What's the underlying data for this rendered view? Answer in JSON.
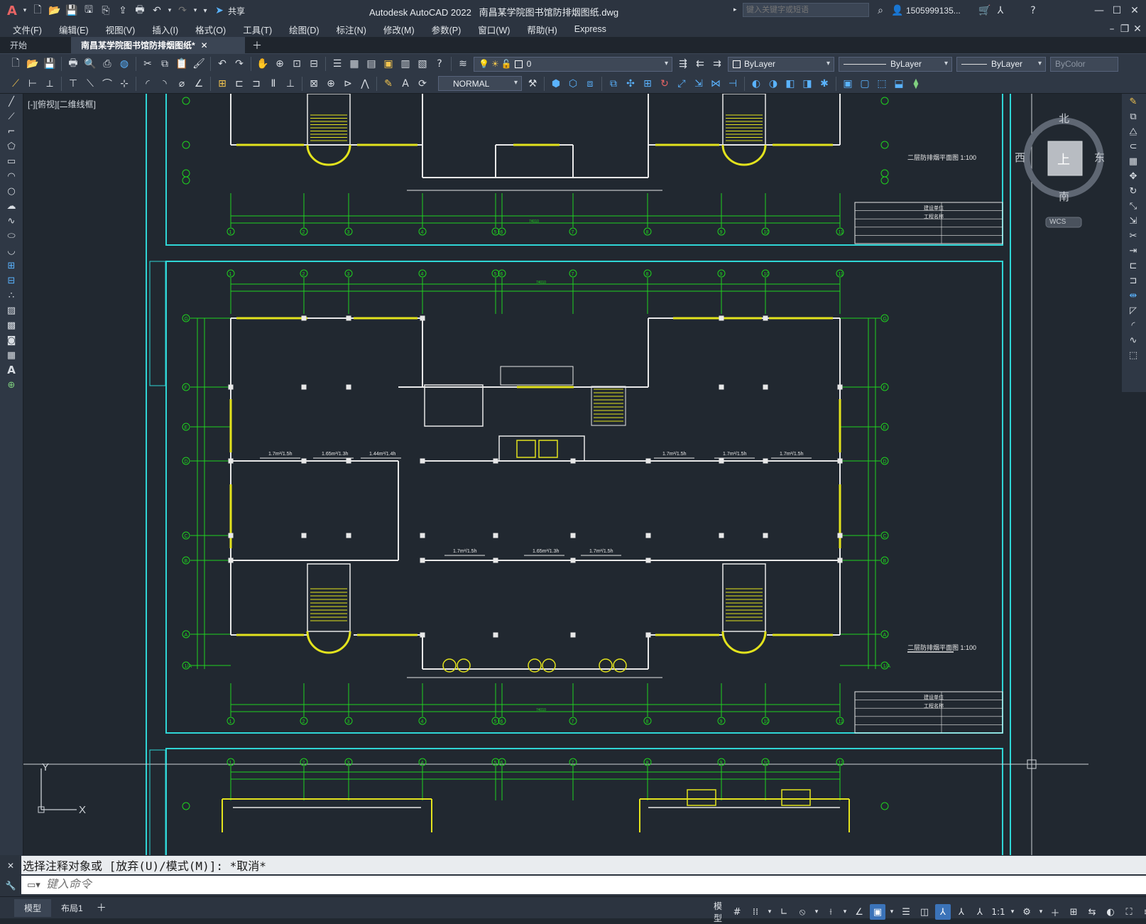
{
  "app": {
    "title": "Autodesk AutoCAD 2022",
    "filename": "南昌某学院图书馆防排烟图纸.dwg",
    "search_placeholder": "键入关键字或短语",
    "user": "1505999135...",
    "share": "共享"
  },
  "menu": [
    "文件(F)",
    "编辑(E)",
    "视图(V)",
    "插入(I)",
    "格式(O)",
    "工具(T)",
    "绘图(D)",
    "标注(N)",
    "修改(M)",
    "参数(P)",
    "窗口(W)",
    "帮助(H)",
    "Express"
  ],
  "tabs": [
    {
      "label": "开始"
    },
    {
      "label": "南昌某学院图书馆防排烟图纸*"
    }
  ],
  "layer": {
    "name": "0"
  },
  "properties": {
    "color": "ByLayer",
    "linetype": "ByLayer",
    "lineweight": "ByLayer",
    "plotstyle": "ByColor"
  },
  "textstyle": "NORMAL",
  "viewport_label": "[-][俯视][二维线框]",
  "viewcube": {
    "north": "北",
    "south": "南",
    "east": "东",
    "west": "西",
    "top": "上",
    "wcs": "WCS"
  },
  "ucs": {
    "x": "X",
    "y": "Y"
  },
  "drawing": {
    "plan_title": "二层防排烟平面图 1:100",
    "title_block": [
      "建设单位",
      "工程名称"
    ],
    "grid_cols": [
      "1",
      "2",
      "3",
      "4",
      "5",
      "6",
      "7",
      "8",
      "9",
      "10",
      "11"
    ],
    "grid_rows": [
      "G",
      "F",
      "E",
      "D",
      "C",
      "B",
      "A",
      "1/A"
    ],
    "annotations": [
      "1.7m²/1.5h",
      "1.65m²/1.3h",
      "1.44m²/1.4h",
      "1.7m²/1.5h",
      "1.65m²/1.3h",
      "1.7m²/1.5h",
      "1.7m²/1.5h",
      "1.7m²/1.5h",
      "1.7m²/1.5h"
    ],
    "total_dim": "74010"
  },
  "command": {
    "history": "选择注释对象或 [放弃(U)/模式(M)]: *取消*",
    "placeholder": "键入命令"
  },
  "status": {
    "model_tab": "模型",
    "layout_tab": "布局1",
    "model_label": "模型",
    "scale": "1:1"
  }
}
